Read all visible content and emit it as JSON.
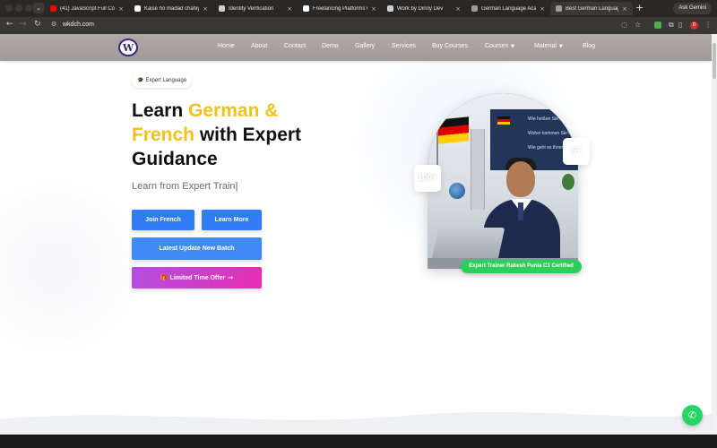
{
  "browser": {
    "tabs": [
      {
        "title": "(41) JavaScript Full Cou",
        "fav_color": "#ff0000",
        "active": false
      },
      {
        "title": "Kaise ho madad chahiye",
        "fav_color": "#ffffff",
        "active": false
      },
      {
        "title": "Identity Verification",
        "fav_color": "#cfcfcf",
        "active": false
      },
      {
        "title": "Freelancing Platforms O",
        "fav_color": "#ffffff",
        "active": false
      },
      {
        "title": "Work by Dinny Dev",
        "fav_color": "#cfcfcf",
        "active": false
      },
      {
        "title": "German Language Acad",
        "fav_color": "#9e9e9e",
        "active": false
      },
      {
        "title": "Best German Language",
        "fav_color": "#9e9e9e",
        "active": true
      }
    ],
    "new_tab": "+",
    "ask_gemini": "Ask Gemini",
    "url": "wkdch.com",
    "profile_initial": "D"
  },
  "site": {
    "logo_letter": "W",
    "nav": {
      "home": "Home",
      "about": "About",
      "contact": "Contact",
      "demo": "Demo",
      "gallery": "Gallery",
      "services": "Services",
      "buy_courses": "Buy Courses",
      "courses": "Courses",
      "material": "Material",
      "blog": "Blog"
    },
    "hero": {
      "badge": "Expert Language",
      "headline_1": "Learn ",
      "headline_accent": "German & French",
      "headline_2": " with Expert Guidance",
      "subline": "Learn from Expert Train",
      "cursor": "|",
      "btn_join": "Join French",
      "btn_more": "Learn More",
      "btn_batch": "Latest Update New Batch",
      "btn_offer": "Limited Time Offer",
      "stat_left": "100+",
      "stat_right": "5+",
      "trainer_label": "Expert Trainer Rakesh Punia C1 Certified",
      "screen_text": [
        "Wie heißen Sie?",
        "Woher kommen Sie?",
        "Wie geht es Ihnen?"
      ]
    }
  },
  "colors": {
    "accent_yellow": "#f2c21b",
    "primary_blue": "#2f7cf6",
    "offer_gradient_start": "#b44de0",
    "offer_gradient_end": "#e62fb3",
    "trainer_green": "#2bcf5c",
    "whatsapp_green": "#25d366",
    "nav_bg": "#a8a19f"
  },
  "icons": {
    "badge_icon": "graduation-cap-icon",
    "offer_icon": "gift-icon",
    "offer_arrow": "arrow-right-icon",
    "whatsapp": "whatsapp-icon"
  }
}
